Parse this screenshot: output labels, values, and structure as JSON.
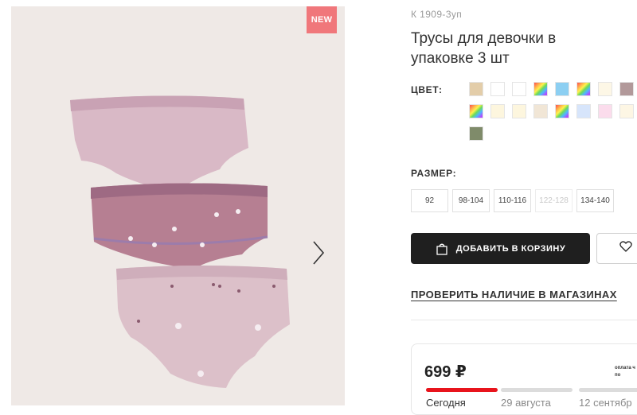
{
  "gallery": {
    "badge": "NEW",
    "image_alt": "three pink girls' underpants"
  },
  "product": {
    "article": "К 1909-3уп",
    "title": "Трусы для девочки в упаковке 3 шт"
  },
  "color": {
    "label": "ЦВЕТ:",
    "swatches": [
      "#e3cda9",
      "#ffffff",
      "#ffffff",
      "rainbow",
      "#8ccff2",
      "rainbow",
      "#fdf7e6",
      "#b2999a",
      "rainbow",
      "#fdf6de",
      "#fdf6de",
      "#f1e6d6",
      "rainbow",
      "#d7e5fb",
      "#fbdcec",
      "#fdf6e4",
      "#7f8b6a"
    ]
  },
  "size": {
    "label": "РАЗМЕР:",
    "options": [
      "92",
      "98-104",
      "110-116",
      "122-128",
      "134-140"
    ],
    "disabled": [
      "122-128"
    ]
  },
  "actions": {
    "add_to_cart": "ДОБАВИТЬ В КОРЗИНУ",
    "check_stores": "ПРОВЕРИТЬ НАЛИЧИЕ В МАГАЗИНАХ"
  },
  "payment": {
    "price": "699 ₽",
    "installment_text": "оплата ч\nпо",
    "schedule": [
      "Сегодня",
      "29 августа",
      "12 сентябр"
    ]
  },
  "colors": {
    "accent": "#e8141c",
    "button_dark": "#1f1f1f",
    "badge": "#f0777b"
  }
}
